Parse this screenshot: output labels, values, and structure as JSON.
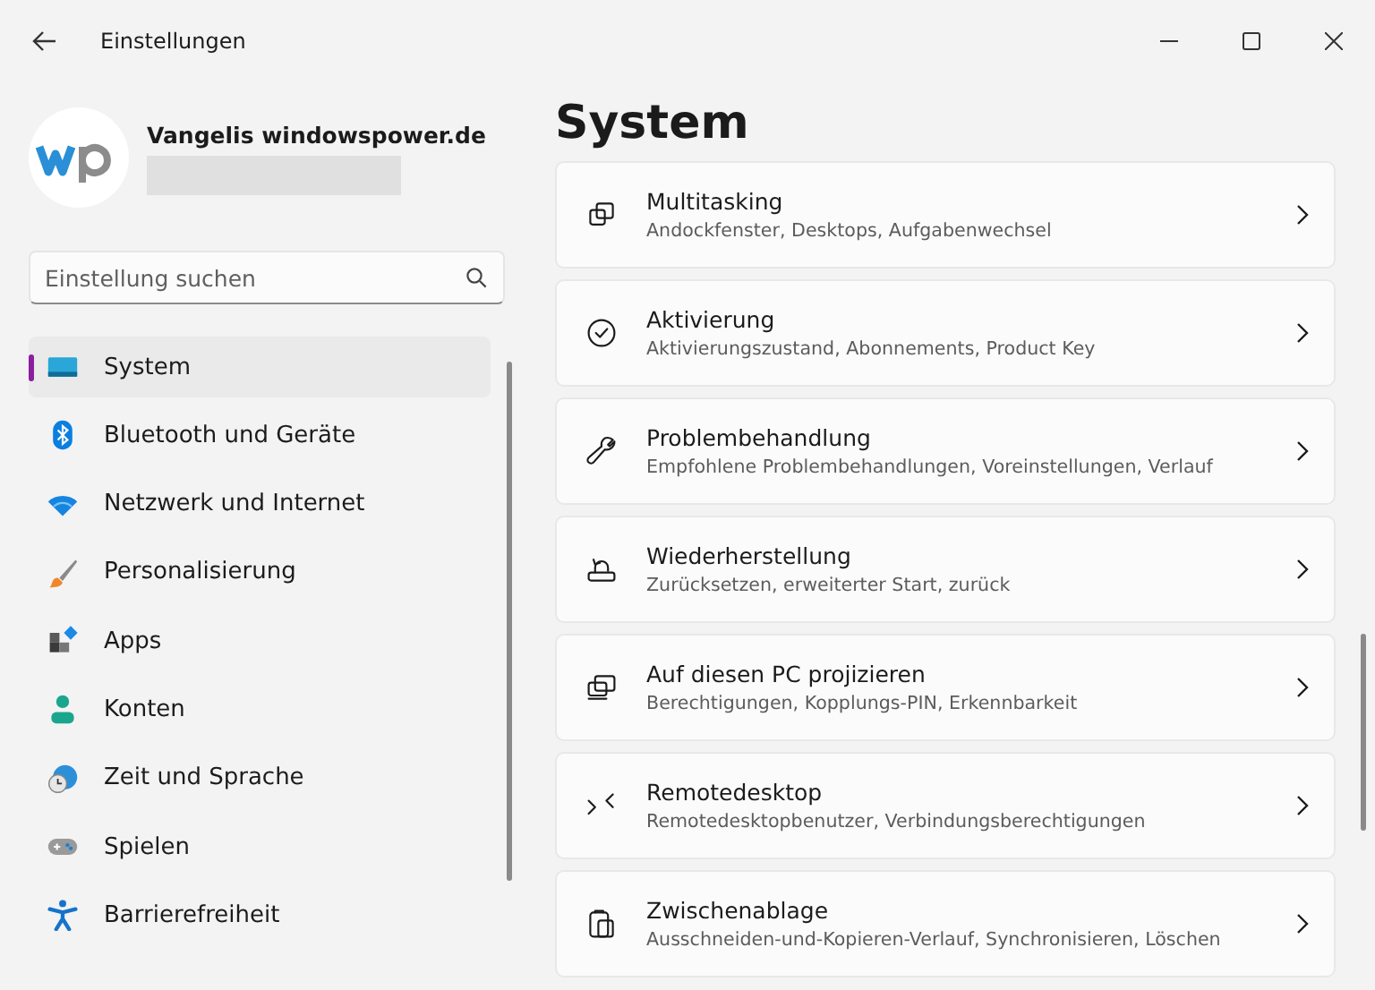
{
  "window": {
    "title": "Einstellungen"
  },
  "profile": {
    "name": "Vangelis windowspower.de"
  },
  "search": {
    "placeholder": "Einstellung suchen"
  },
  "nav": [
    {
      "label": "System",
      "kind": "system",
      "selected": true
    },
    {
      "label": "Bluetooth und Geräte",
      "kind": "bluetooth",
      "selected": false
    },
    {
      "label": "Netzwerk und Internet",
      "kind": "network",
      "selected": false
    },
    {
      "label": "Personalisierung",
      "kind": "brush",
      "selected": false
    },
    {
      "label": "Apps",
      "kind": "apps",
      "selected": false
    },
    {
      "label": "Konten",
      "kind": "account",
      "selected": false
    },
    {
      "label": "Zeit und Sprache",
      "kind": "time",
      "selected": false
    },
    {
      "label": "Spielen",
      "kind": "gaming",
      "selected": false
    },
    {
      "label": "Barrierefreiheit",
      "kind": "accessibility",
      "selected": false
    }
  ],
  "page": {
    "title": "System"
  },
  "settings": [
    {
      "title": "Multitasking",
      "description": "Andockfenster, Desktops, Aufgabenwechsel",
      "kind": "multitasking"
    },
    {
      "title": "Aktivierung",
      "description": "Aktivierungszustand, Abonnements, Product Key",
      "kind": "activation"
    },
    {
      "title": "Problembehandlung",
      "description": "Empfohlene Problembehandlungen, Voreinstellungen, Verlauf",
      "kind": "troubleshoot"
    },
    {
      "title": "Wiederherstellung",
      "description": "Zurücksetzen, erweiterter Start, zurück",
      "kind": "recovery"
    },
    {
      "title": "Auf diesen PC projizieren",
      "description": "Berechtigungen, Kopplungs-PIN, Erkennbarkeit",
      "kind": "project"
    },
    {
      "title": "Remotedesktop",
      "description": "Remotedesktopbenutzer, Verbindungsberechtigungen",
      "kind": "remote"
    },
    {
      "title": "Zwischenablage",
      "description": "Ausschneiden-und-Kopieren-Verlauf, Synchronisieren, Löschen",
      "kind": "clipboard"
    }
  ]
}
